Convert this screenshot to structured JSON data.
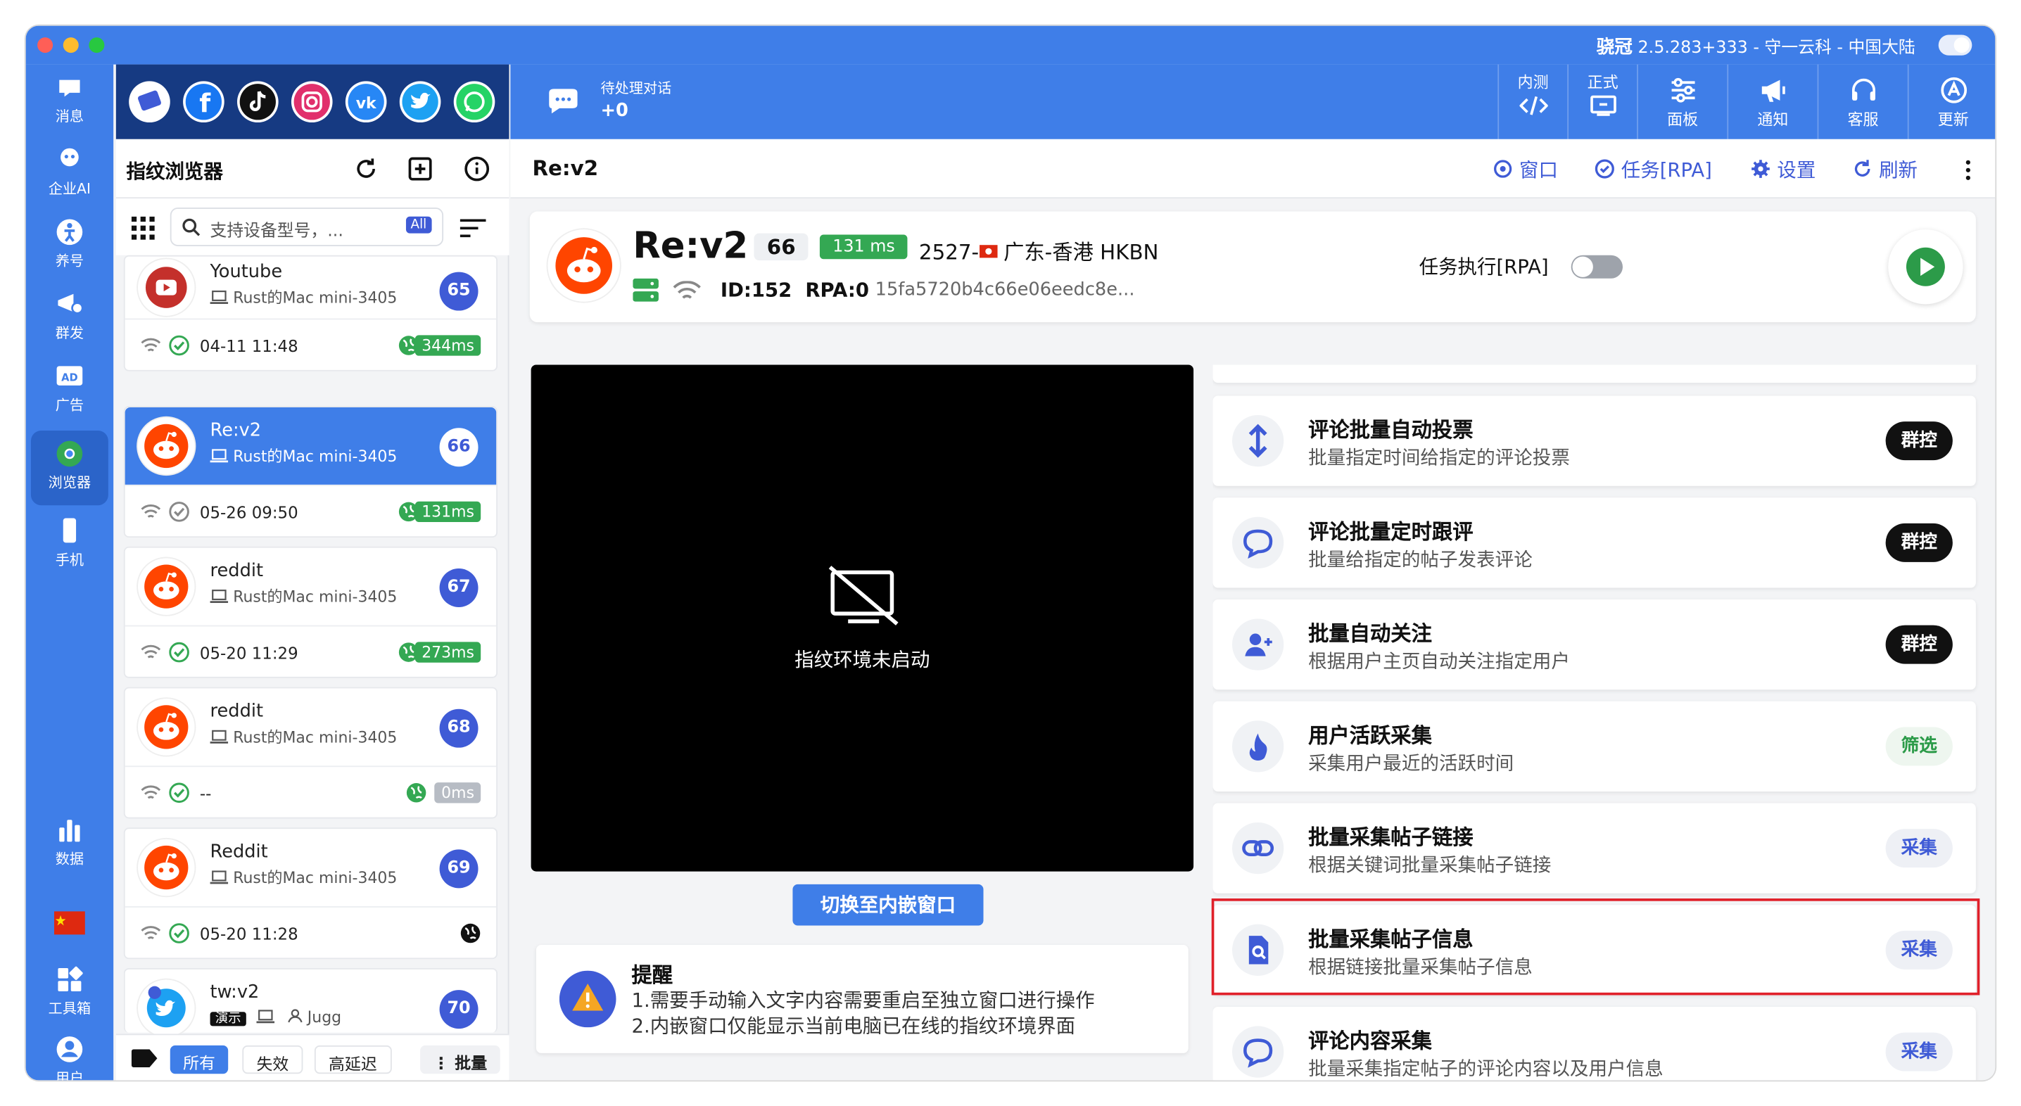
{
  "titlebar": {
    "app_name": "骁冠",
    "app_info": "2.5.283+333 - 守一云科 - 中国大陆"
  },
  "rail": [
    {
      "label": "消息",
      "icon": "message-icon"
    },
    {
      "label": "企业AI",
      "icon": "ai-icon"
    },
    {
      "label": "养号",
      "icon": "nurture-icon"
    },
    {
      "label": "群发",
      "icon": "broadcast-icon"
    },
    {
      "label": "广告",
      "icon": "ad-icon"
    },
    {
      "label": "浏览器",
      "icon": "browser-icon"
    },
    {
      "label": "手机",
      "icon": "phone-icon"
    },
    {
      "label": "数据",
      "icon": "data-icon"
    },
    {
      "label": "",
      "icon": "china-flag-icon"
    },
    {
      "label": "工具箱",
      "icon": "toolbox-icon"
    },
    {
      "label": "用户",
      "icon": "user-icon"
    }
  ],
  "topbar": {
    "pending_label": "待处理对话",
    "pending_count": "+0",
    "buttons": [
      {
        "label": "内测",
        "icon": "code-icon"
      },
      {
        "label": "正式",
        "icon": "release-icon"
      },
      {
        "label": "面板",
        "icon": "sliders-icon"
      },
      {
        "label": "通知",
        "icon": "megaphone-icon"
      },
      {
        "label": "客服",
        "icon": "headset-icon"
      },
      {
        "label": "更新",
        "icon": "update-icon"
      }
    ]
  },
  "listpanel": {
    "title": "指纹浏览器",
    "search_placeholder": "支持设备型号，...",
    "all_badge": "All",
    "filters": [
      "所有",
      "失效",
      "高延迟"
    ],
    "batch": "批量",
    "cards": [
      {
        "name": "Youtube",
        "device": "Rust的Mac mini-3405",
        "num": "65",
        "time": "04-11 11:48",
        "ms": "344ms"
      },
      {
        "name": "Re:v2",
        "device": "Rust的Mac mini-3405",
        "num": "66",
        "time": "05-26 09:50",
        "ms": "131ms"
      },
      {
        "name": "reddit",
        "device": "Rust的Mac mini-3405",
        "num": "67",
        "time": "05-20 11:29",
        "ms": "273ms"
      },
      {
        "name": "reddit",
        "device": "Rust的Mac mini-3405",
        "num": "68",
        "time": "--",
        "ms": "0ms"
      },
      {
        "name": "Reddit",
        "device": "Rust的Mac mini-3405",
        "num": "69",
        "time": "05-20 11:28",
        "ms": ""
      },
      {
        "name": "tw:v2",
        "device": "Jugg",
        "num": "70",
        "demo": "演示"
      }
    ]
  },
  "main": {
    "title": "Re:v2",
    "actions": [
      "窗口",
      "任务[RPA]",
      "设置",
      "刷新"
    ],
    "hero": {
      "name": "Re:v2",
      "num": "66",
      "ms": "131 ms",
      "loc_prefix": "2527-",
      "loc": "广东-香港 HKBN",
      "id": "ID:152",
      "rpa": "RPA:0",
      "hash": "15fa5720b4c66e06eedc8e...",
      "rpa_toggle_label": "任务执行[RPA]"
    },
    "screen_text": "指纹环境未启动",
    "switch_button": "切换至内嵌窗口",
    "reminder": {
      "title": "提醒",
      "line1": "1.需要手动输入文字内容需要重启至独立窗口进行操作",
      "line2": "2.内嵌窗口仅能显示当前电脑已在线的指纹环境界面"
    },
    "tasks": [
      {
        "title": "评论批量自动投票",
        "desc": "批量指定时间给指定的评论投票",
        "btn": "群控",
        "style": "dark",
        "icon": "updown-arrow-icon"
      },
      {
        "title": "评论批量定时跟评",
        "desc": "批量给指定的帖子发表评论",
        "btn": "群控",
        "style": "dark",
        "icon": "comment-icon"
      },
      {
        "title": "批量自动关注",
        "desc": "根据用户主页自动关注指定用户",
        "btn": "群控",
        "style": "dark",
        "icon": "follow-user-icon"
      },
      {
        "title": "用户活跃采集",
        "desc": "采集用户最近的活跃时间",
        "btn": "筛选",
        "style": "green",
        "icon": "fire-icon"
      },
      {
        "title": "批量采集帖子链接",
        "desc": "根据关键词批量采集帖子链接",
        "btn": "采集",
        "style": "blue",
        "icon": "link-icon"
      },
      {
        "title": "批量采集帖子信息",
        "desc": "根据链接批量采集帖子信息",
        "btn": "采集",
        "style": "blue",
        "icon": "doc-search-icon"
      },
      {
        "title": "评论内容采集",
        "desc": "批量采集指定帖子的评论内容以及用户信息",
        "btn": "采集",
        "style": "blue",
        "icon": "comment-icon"
      }
    ]
  }
}
